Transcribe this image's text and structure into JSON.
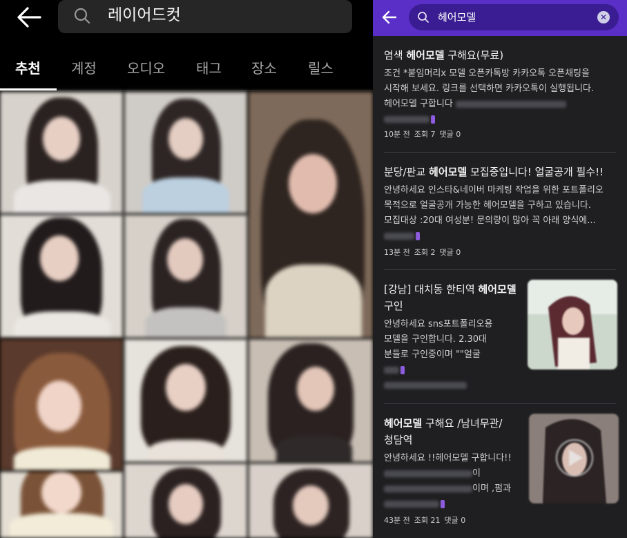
{
  "left": {
    "search_query": "레이어드컷",
    "tabs": [
      "추천",
      "계정",
      "오디오",
      "태그",
      "장소",
      "릴스"
    ],
    "active_tab": "추천"
  },
  "right": {
    "search_query": "헤어모델",
    "posts": [
      {
        "title_prefix": "염색 ",
        "title_highlight": "헤어모델",
        "title_suffix": " 구해요(무료)",
        "body_lines": [
          "조건 *붙임머리x 모델 오픈카톡방 카카오톡 오픈채팅을",
          "시작해 보세요. 링크를 선택하면 카카오톡이 실행됩니다.",
          "헤어모델 구합니다"
        ],
        "time": "10분 전",
        "views": "조회 7",
        "comments": "댓글 0"
      },
      {
        "title_prefix": "분당/판교 ",
        "title_highlight": "헤어모델",
        "title_suffix": " 모집중입니다! 얼굴공개 필수!!",
        "body_lines": [
          "안녕하세요 인스타&네이버 마케팅 작업을 위한 포트폴리오",
          "목적으로 얼굴공개 가능한 헤어모델을 구하고 있습니다.",
          "모집대상 :20대 여성분! 문의량이 많아 꼭 아래 양식에..."
        ],
        "time": "13분 전",
        "views": "조회 2",
        "comments": "댓글 0"
      },
      {
        "title_prefix": "[강남] 대치동 한티역 ",
        "title_highlight": "헤어모델",
        "title_line2": "구인",
        "body_lines": [
          "안녕하세요 sns포트폴리오용",
          "모델을 구인합니다. 2.30대",
          "분들로 구인중이며 \"\"얼굴"
        ]
      },
      {
        "title_highlight": "헤어모델",
        "title_suffix": " 구해요 /남녀무관/",
        "title_line2": "청담역",
        "body_lines": [
          "안녕하세요 !!헤어모델 구합니다!!",
          "이",
          "이며 ,펌과"
        ],
        "time": "43분 전",
        "views": "조회 21",
        "comments": "댓글 0"
      }
    ]
  },
  "icons": {
    "left_back": "arrow-left-icon",
    "left_search": "search-icon",
    "right_back": "arrow-left-icon",
    "right_search": "search-icon",
    "right_clear": "clear-icon"
  },
  "colors": {
    "accent": "#5a2fc8",
    "panel_dark": "#1f1f21",
    "left_bg": "#000000"
  }
}
